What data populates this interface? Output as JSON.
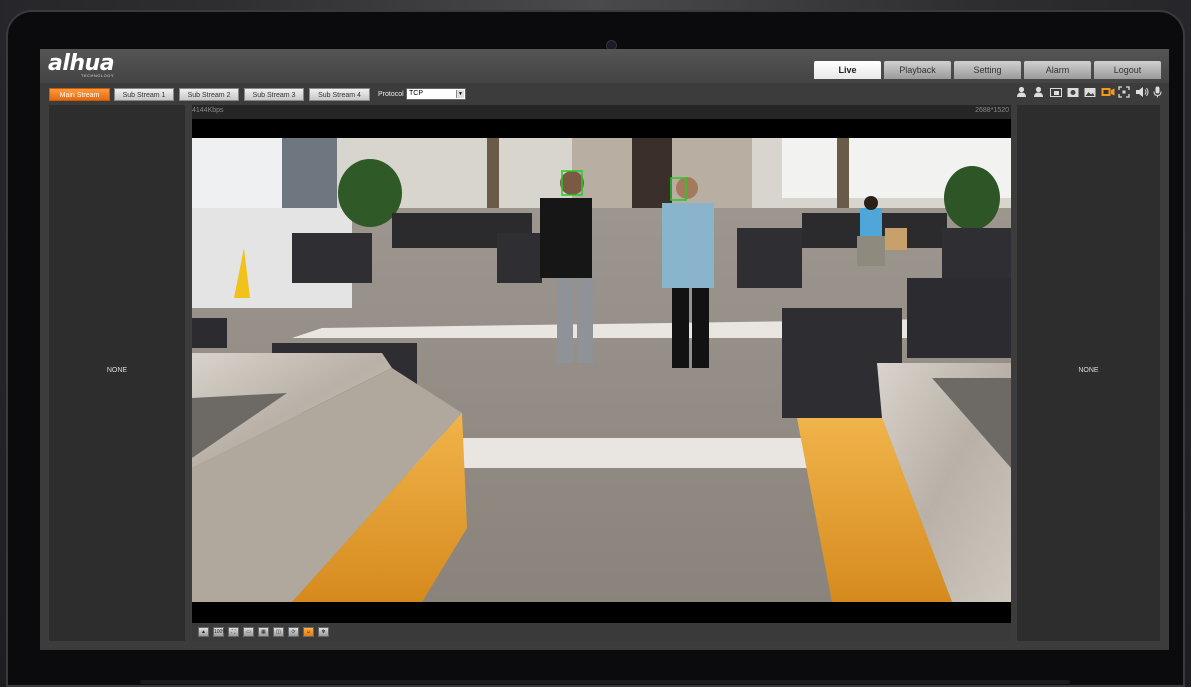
{
  "app": {
    "logo_text": "alhua",
    "logo_subtext": "TECHNOLOGY"
  },
  "nav": {
    "tabs": [
      {
        "label": "Live",
        "active": true
      },
      {
        "label": "Playback",
        "active": false
      },
      {
        "label": "Setting",
        "active": false
      },
      {
        "label": "Alarm",
        "active": false
      },
      {
        "label": "Logout",
        "active": false
      }
    ]
  },
  "streams": {
    "buttons": [
      {
        "label": "Main Stream",
        "active": true
      },
      {
        "label": "Sub Stream 1",
        "active": false
      },
      {
        "label": "Sub Stream 2",
        "active": false
      },
      {
        "label": "Sub Stream 3",
        "active": false
      },
      {
        "label": "Sub Stream 4",
        "active": false
      }
    ],
    "protocol_label": "Protocol",
    "protocol_value": "TCP"
  },
  "toolbar_icons": [
    "person-icon",
    "person-icon",
    "zoom-icon",
    "snapshot-icon",
    "image-icon",
    "record-icon",
    "fullscreen-icon",
    "speaker-icon",
    "microphone-icon"
  ],
  "video": {
    "bitrate": "4144Kbps",
    "resolution": "2688*1520"
  },
  "side_panels": {
    "left_label": "NONE",
    "right_label": "NONE"
  },
  "video_controls": {
    "buttons": [
      {
        "icon": "aspect-icon",
        "label": ""
      },
      {
        "icon": "ratio-icon",
        "label": "100%"
      },
      {
        "icon": "fit-icon",
        "label": ""
      },
      {
        "icon": "window-icon",
        "label": ""
      },
      {
        "icon": "grid-icon",
        "label": ""
      },
      {
        "icon": "split-icon",
        "label": ""
      },
      {
        "icon": "refresh-icon",
        "label": ""
      },
      {
        "icon": "face-icon",
        "label": ""
      },
      {
        "icon": "settings-icon",
        "label": ""
      }
    ]
  },
  "colors": {
    "accent_orange": "#f0781e",
    "face_box": "#22cc22"
  }
}
